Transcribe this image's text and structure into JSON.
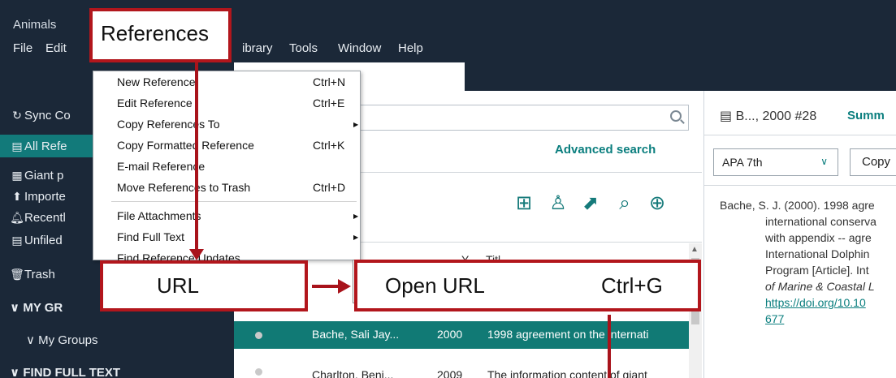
{
  "app": {
    "title": "Animals"
  },
  "menubar": {
    "file": "File",
    "edit": "Edit",
    "library": "ibrary",
    "tools": "Tools",
    "window": "Window",
    "help": "Help"
  },
  "sidebar": {
    "sync": "Sync Co",
    "items": [
      "All Refe",
      "Giant p",
      "Importe",
      "Recentl",
      "Unfiled",
      "Trash"
    ],
    "my_groups_header": "MY GR",
    "my_groups_sub": "My Groups",
    "find_full_text_header": "FIND FULL TEXT"
  },
  "dropdown": {
    "items": [
      {
        "label": "New Reference",
        "shortcut": "Ctrl+N"
      },
      {
        "label": "Edit Reference",
        "shortcut": "Ctrl+E"
      },
      {
        "label": "Copy References To",
        "shortcut": ""
      },
      {
        "label": "Copy Formatted Reference",
        "shortcut": "Ctrl+K"
      },
      {
        "label": "E-mail Reference",
        "shortcut": ""
      },
      {
        "label": "Move References to Trash",
        "shortcut": "Ctrl+D"
      },
      {
        "label": "File Attachments",
        "shortcut": ""
      },
      {
        "label": "Find Full Text",
        "shortcut": ""
      },
      {
        "label": "Find Reference Updates",
        "shortcut": ""
      }
    ]
  },
  "callouts": {
    "references": "References",
    "url": "URL",
    "open_url": "Open URL",
    "open_url_shortcut": "Ctrl+G"
  },
  "main": {
    "advanced_search": "Advanced search",
    "columns": {
      "year": "Y",
      "title": "Titl"
    },
    "rows": [
      {
        "author": "Bache, Sali Jay...",
        "year": "2000",
        "title": "1998 agreement on the internati"
      },
      {
        "author": "Charlton, Beni...",
        "year": "2009",
        "title": "The information content of giant"
      }
    ]
  },
  "right": {
    "ref_title": "B..., 2000 #28",
    "tab_summary": "Summ",
    "style_value": "APA 7th",
    "copy_label": "Copy",
    "citation": {
      "lines": [
        "Bache, S. J. (2000). 1998 agre",
        "international conserva",
        "with appendix -- agre",
        "International Dolphin",
        "Program [Article]. Int",
        "of Marine & Coastal L"
      ],
      "doi1": "https://doi.org/10.10",
      "doi2": "677"
    }
  },
  "colors": {
    "dark": "#1b2838",
    "teal": "#127a7a",
    "highlight": "#b2161c"
  }
}
